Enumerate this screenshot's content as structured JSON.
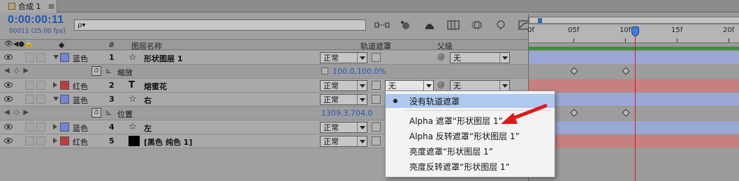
{
  "tab": {
    "title": "合成 1",
    "close": "≡"
  },
  "time": {
    "timecode": "0:00:00:11",
    "frames": "00011 (25.00 fps)"
  },
  "search": {
    "glyph": "ρ▾"
  },
  "header": {
    "hash": "#",
    "layer_name": "图层名称",
    "track_matte": "轨道遮罩",
    "parent": "父级"
  },
  "layers": [
    {
      "label": "蓝色",
      "num": "1",
      "type_icon": "☆",
      "name": "形状图层 1",
      "mode": "正常",
      "parent": "无"
    },
    {
      "prop": "缩放",
      "value": "100.0,100.0%"
    },
    {
      "label": "红色",
      "num": "2",
      "type_icon": "T",
      "name": "熔蜜花",
      "mode": "正常",
      "matte": "无",
      "parent": "无"
    },
    {
      "label": "蓝色",
      "num": "3",
      "type_icon": "☆",
      "name": "右",
      "mode": "正常"
    },
    {
      "prop": "位置",
      "value": "1309.3,704.0"
    },
    {
      "label": "蓝色",
      "num": "4",
      "type_icon": "☆",
      "name": "左",
      "mode": "正常"
    },
    {
      "label": "红色",
      "num": "5",
      "type_icon": "■",
      "name": "[黑色 纯色 1]",
      "mode": "正常"
    }
  ],
  "colors": {
    "blue_label": "#6f86d8",
    "red_label": "#c13b3b",
    "black_solid": "#000000",
    "bar_blue": "#9aa7d6",
    "bar_red": "#c77f7f",
    "cti": "#d02020",
    "accent": "#1e56b8"
  },
  "ruler": {
    "ticks": [
      "0f",
      "05f",
      "10f",
      "15f",
      "20f"
    ],
    "current_frame": 11
  },
  "menu": {
    "items": [
      {
        "label": "没有轨道遮罩",
        "selected": true
      },
      {
        "label": "Alpha 遮罩“形状图层 1”"
      },
      {
        "label": "Alpha 反转遮罩“形状图层 1”"
      },
      {
        "label": "亮度遮罩“形状图层 1”"
      },
      {
        "label": "亮度反转遮罩“形状图层 1”"
      }
    ]
  }
}
